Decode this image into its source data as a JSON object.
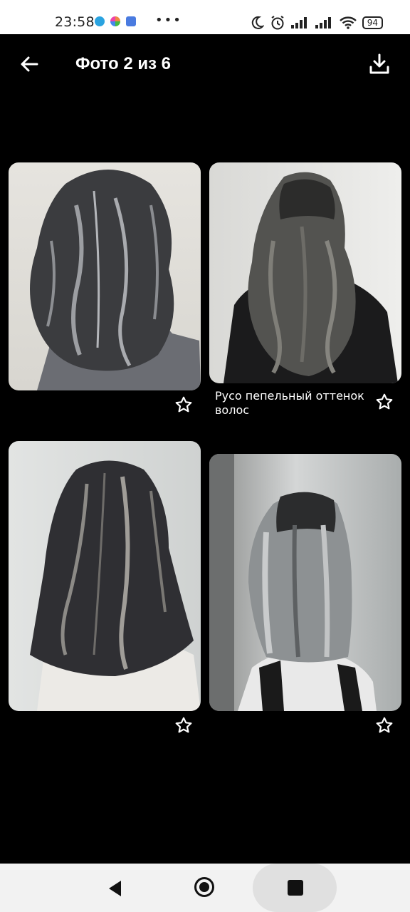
{
  "status": {
    "time": "23:58",
    "more": "•••",
    "battery": "94"
  },
  "appbar": {
    "title": "Фото 2 из 6"
  },
  "photos": [
    {
      "caption": ""
    },
    {
      "caption": "Русо пепельный оттенок волос"
    },
    {
      "caption": ""
    },
    {
      "caption": ""
    }
  ],
  "icons": {
    "back": "arrow-left-icon",
    "download": "download-icon",
    "star": "star-outline-icon"
  }
}
